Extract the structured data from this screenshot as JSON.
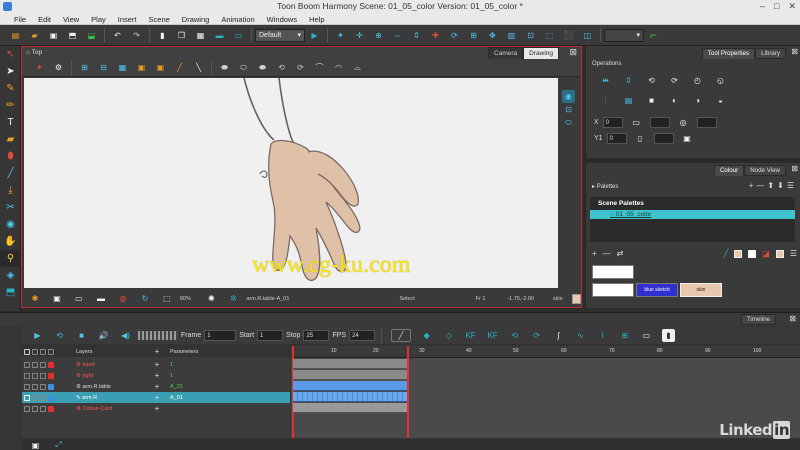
{
  "window": {
    "title": "Toon Boom Harmony Scene: 01_05_color Version: 01_05_color *",
    "controls": [
      "–",
      "□",
      "✕"
    ]
  },
  "menubar": [
    "File",
    "Edit",
    "View",
    "Play",
    "Insert",
    "Scene",
    "Drawing",
    "Animation",
    "Windows",
    "Help"
  ],
  "toolbar": {
    "workspace_combo": "Default"
  },
  "camera": {
    "top_label": "Top",
    "tabs": [
      "Camera",
      "Drawing"
    ],
    "active_tab": "Camera",
    "status": {
      "zoom": "80%",
      "node": "arm.R.table-A_01",
      "mode": "Select",
      "frame": "Fr 1",
      "coords": "-1.75,-2.00",
      "skin": "skin"
    }
  },
  "tool_properties": {
    "tabs": [
      "Tool Properties",
      "Library"
    ],
    "active_tab": "Tool Properties",
    "section": "Operations",
    "fields": [
      {
        "label": "X",
        "value": "0"
      },
      {
        "label": "Y1",
        "value": "0"
      }
    ]
  },
  "colour_panel": {
    "tabs": [
      "Colour",
      "Node View"
    ],
    "active_tab": "Colour",
    "palettes_label": "Palettes",
    "scene_palettes_label": "Scene Palettes",
    "palette_item": "01_05_color",
    "swatches": [
      {
        "label": "",
        "color": "#ffffff"
      },
      {
        "label": "blue sketch",
        "color": "#3030d0"
      },
      {
        "label": "skin",
        "color": "#e8c9ae"
      },
      {
        "label": "",
        "color": "#ffffff"
      }
    ]
  },
  "timeline": {
    "title": "Timeline",
    "frame_label": "Frame",
    "frame_value": "1",
    "start_label": "Start",
    "start_value": "1",
    "stop_label": "Stop",
    "stop_value": "25",
    "fps_label": "FPS",
    "fps_value": "24",
    "layers_header": "Layers",
    "params_header": "Parameters",
    "ruler_ticks": [
      "10",
      "20",
      "30",
      "40",
      "50",
      "60",
      "70",
      "80",
      "90",
      "100"
    ],
    "layers": [
      {
        "name": "hand",
        "param": "1",
        "name_color": "red",
        "color": "#e23030"
      },
      {
        "name": "right",
        "param": "1",
        "name_color": "red",
        "color": "#e23030"
      },
      {
        "name": "arm.R.table",
        "param": "A_21",
        "name_color": "white",
        "color": "#3f8fe0"
      },
      {
        "name": "arm.R",
        "param": "A_01",
        "name_color": "white",
        "color": "#3f8fe0",
        "selected": true
      },
      {
        "name": "Colour-Card",
        "param": "",
        "name_color": "red",
        "color": "#e23030"
      }
    ]
  },
  "branding": {
    "logo_text": "Linked",
    "logo_in": "in",
    "watermark": "www.cg-ku.com"
  }
}
